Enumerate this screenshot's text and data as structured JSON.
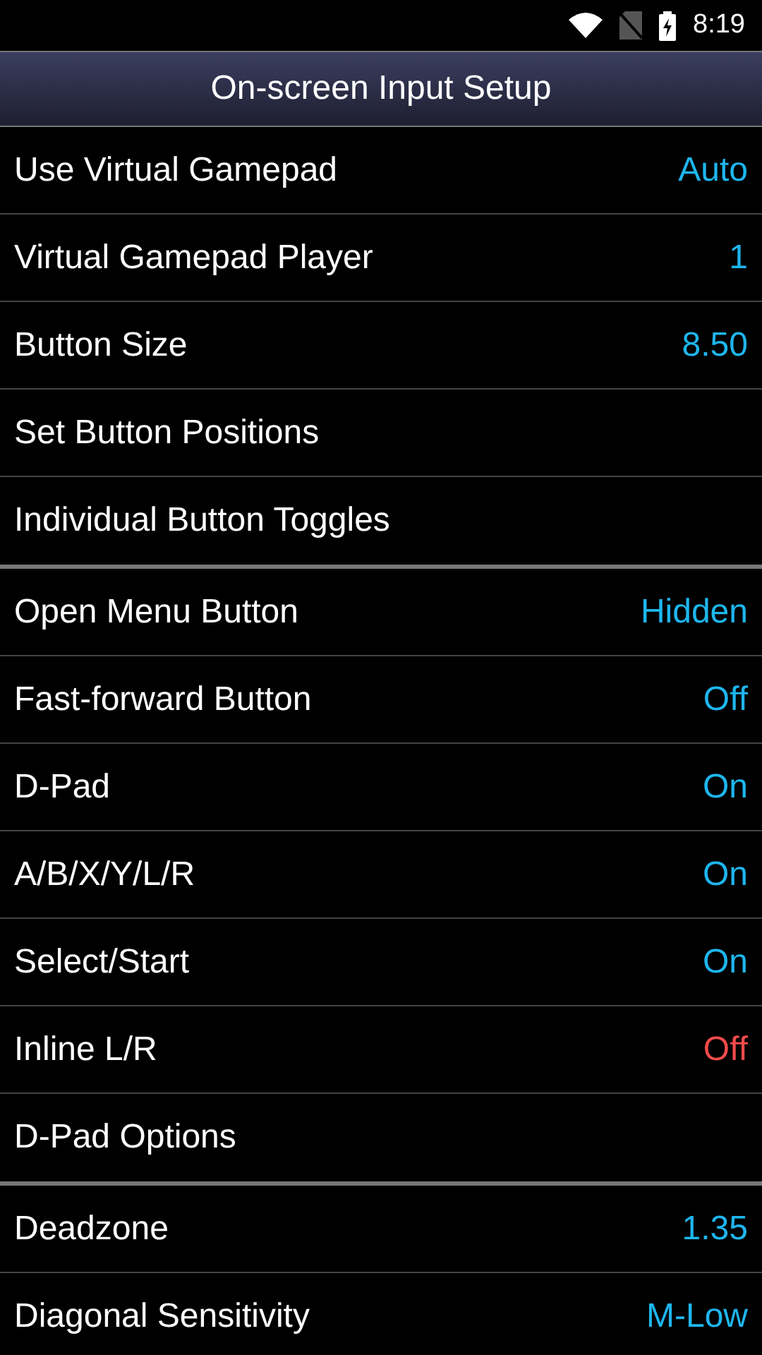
{
  "status_bar": {
    "time": "8:19"
  },
  "header": {
    "title": "On-screen Input Setup"
  },
  "sections": [
    {
      "rows": [
        {
          "label": "Use Virtual Gamepad",
          "value": "Auto",
          "color": "#1eb6ee"
        },
        {
          "label": "Virtual Gamepad Player",
          "value": "1",
          "color": "#1eb6ee"
        },
        {
          "label": "Button Size",
          "value": "8.50",
          "color": "#1eb6ee"
        },
        {
          "label": "Set Button Positions"
        },
        {
          "label": "Individual Button Toggles"
        }
      ]
    },
    {
      "rows": [
        {
          "label": "Open Menu Button",
          "value": "Hidden",
          "color": "#1eb6ee"
        },
        {
          "label": "Fast-forward Button",
          "value": "Off",
          "color": "#1eb6ee"
        },
        {
          "label": "D-Pad",
          "value": "On",
          "color": "#1eb6ee"
        },
        {
          "label": "A/B/X/Y/L/R",
          "value": "On",
          "color": "#1eb6ee"
        },
        {
          "label": "Select/Start",
          "value": "On",
          "color": "#1eb6ee"
        },
        {
          "label": "Inline L/R",
          "value": "Off",
          "color": "#f24b4b"
        },
        {
          "label": "D-Pad Options"
        }
      ]
    },
    {
      "rows": [
        {
          "label": "Deadzone",
          "value": "1.35",
          "color": "#1eb6ee"
        },
        {
          "label": "Diagonal Sensitivity",
          "value": "M-Low",
          "color": "#1eb6ee"
        }
      ]
    }
  ]
}
